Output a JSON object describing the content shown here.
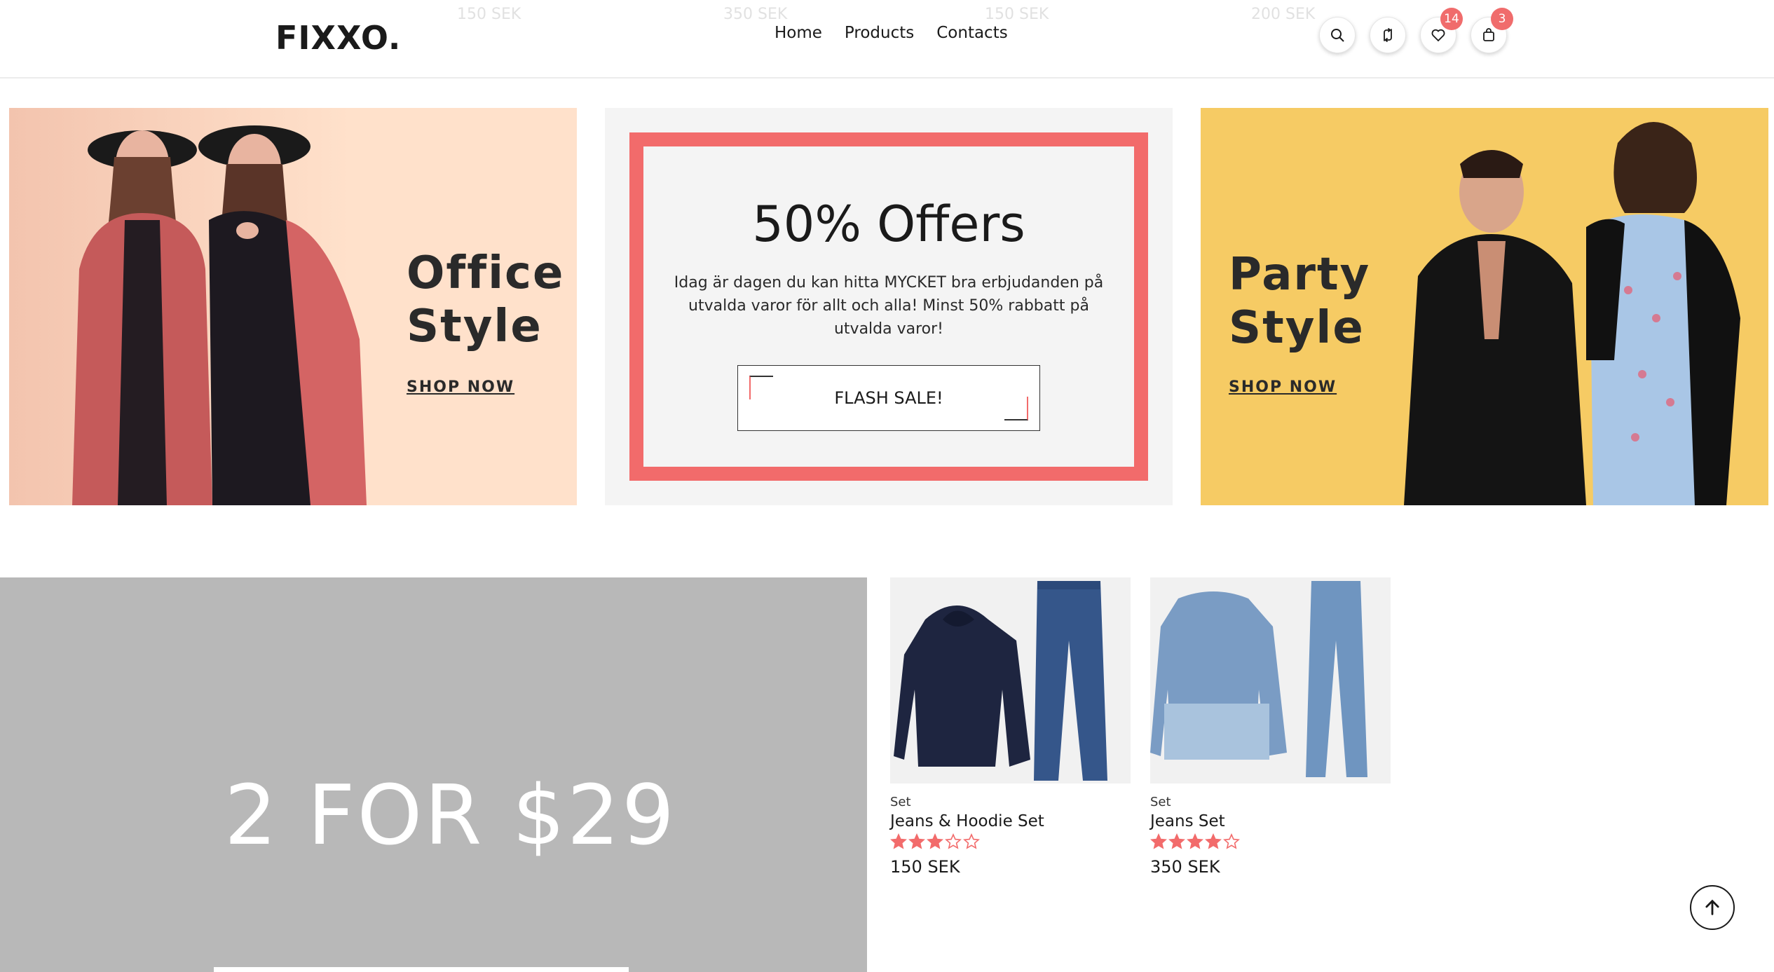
{
  "ghost_prices": [
    "150 SEK",
    "350 SEK",
    "150 SEK",
    "200 SEK"
  ],
  "header": {
    "logo": "FIXXO.",
    "nav": [
      "Home",
      "Products",
      "Contacts"
    ],
    "icons": [
      "search-icon",
      "compare-icon",
      "heart-icon",
      "bag-icon"
    ],
    "wishlist_count": "14",
    "cart_count": "3",
    "badge_color": "#f06c6c"
  },
  "banners": {
    "office": {
      "title_line1": "Office",
      "title_line2": "Style",
      "cta": "SHOP NOW"
    },
    "offer": {
      "title": "50% Offers",
      "text": "Idag är dagen du kan hitta MYCKET bra erbjudanden på utvalda varor för allt och alla! Minst 50% rabbatt på utvalda varor!",
      "button": "FLASH SALE!",
      "accent": "#f26b6b"
    },
    "party": {
      "title_line1": "Party",
      "title_line2": "Style",
      "cta": "SHOP NOW"
    }
  },
  "promo": {
    "text": "2 FOR $29"
  },
  "products": [
    {
      "category": "Set",
      "name": "Jeans & Hoodie Set",
      "rating": 3,
      "max_rating": 5,
      "price": "150 SEK"
    },
    {
      "category": "Set",
      "name": "Jeans Set",
      "rating": 4,
      "max_rating": 5,
      "price": "350 SEK"
    }
  ],
  "colors": {
    "star": "#f26b6b",
    "promo_bg": "#b8b8b8",
    "party_bg": "#f6cb64",
    "office_bg": "#ffe1cb"
  }
}
